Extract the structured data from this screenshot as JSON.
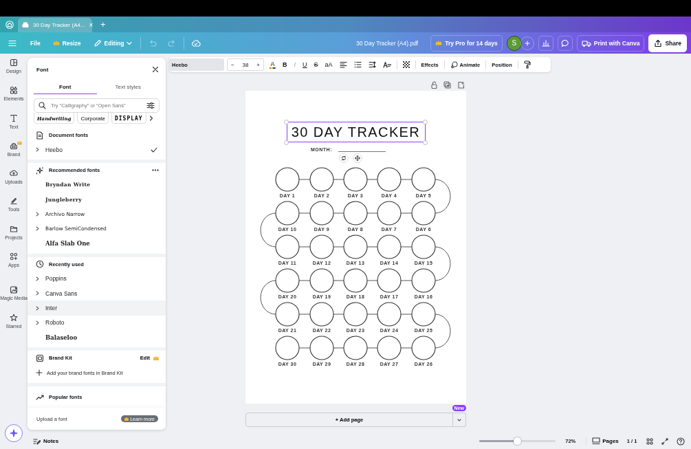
{
  "browser_tab": {
    "title": "30 Day Tracker (A4...",
    "close": "×",
    "new_tab": "+"
  },
  "toolbar": {
    "file": "File",
    "resize": "Resize",
    "editing": "Editing",
    "document_name": "30 Day Tracker (A4).pdf",
    "try_pro": "Try Pro for 14 days",
    "avatar": "S",
    "print": "Print with Canva",
    "share": "Share"
  },
  "rail": [
    {
      "label": "Design",
      "badge": false
    },
    {
      "label": "Elements",
      "badge": false
    },
    {
      "label": "Text",
      "badge": false
    },
    {
      "label": "Brand",
      "badge": true
    },
    {
      "label": "Uploads",
      "badge": false
    },
    {
      "label": "Tools",
      "badge": false
    },
    {
      "label": "Projects",
      "badge": false
    },
    {
      "label": "Apps",
      "badge": false
    },
    {
      "label": "Magic Media",
      "badge": false
    },
    {
      "label": "Starred",
      "badge": false
    }
  ],
  "font_panel": {
    "title": "Font",
    "tabs": [
      {
        "label": "Font",
        "selected": true
      },
      {
        "label": "Text styles",
        "selected": false
      }
    ],
    "search": {
      "placeholder": "Try “Calligraphy” or “Open Sans”"
    },
    "categories": [
      "Handwriting",
      "Corporate",
      "DISPLAY"
    ],
    "sections": [
      {
        "kind": "document",
        "title": "Document fonts",
        "items": [
          {
            "name": "Heebo",
            "kind": "expandable",
            "checked": true,
            "highlighted": false
          }
        ]
      },
      {
        "kind": "recommended",
        "title": "Recommended fonts",
        "items": [
          {
            "name": "Bryndan Write",
            "kind": "script",
            "checked": false,
            "highlighted": false
          },
          {
            "name": "Jungleberry",
            "kind": "script",
            "checked": false,
            "highlighted": false
          },
          {
            "name": "Archivo Narrow",
            "kind": "expandable",
            "checked": false,
            "highlighted": false
          },
          {
            "name": "Barlow SemiCondensed",
            "kind": "expandable",
            "checked": false,
            "highlighted": false
          },
          {
            "name": "Alfa Slab One",
            "kind": "slab",
            "checked": false,
            "highlighted": false
          }
        ]
      },
      {
        "kind": "recent",
        "title": "Recently used",
        "items": [
          {
            "name": "Poppins",
            "kind": "expandable",
            "checked": false,
            "highlighted": false
          },
          {
            "name": "Canva Sans",
            "kind": "expandable",
            "checked": false,
            "highlighted": false
          },
          {
            "name": "Inter",
            "kind": "expandable",
            "checked": false,
            "highlighted": true
          },
          {
            "name": "Roboto",
            "kind": "expandable",
            "checked": false,
            "highlighted": false
          },
          {
            "name": "Balaseloo",
            "kind": "slab",
            "checked": false,
            "highlighted": false
          }
        ]
      }
    ],
    "brand_kit": {
      "title": "Brand Kit",
      "edit": "Edit",
      "add": "Add your brand fonts in Brand Kit"
    },
    "popular": "Popular fonts",
    "upload": "Upload a font",
    "learn_more": "Learn more"
  },
  "text_toolbar": {
    "font": "Heebo",
    "minus": "−",
    "size": "38",
    "plus": "+",
    "color_letter": "A",
    "bold": "B",
    "italic": "I",
    "underline": "U",
    "strike": "S",
    "case": "aA",
    "effects": "Effects",
    "animate": "Animate",
    "position": "Position"
  },
  "document": {
    "title": "30 DAY TRACKER",
    "title_selected": true,
    "month_label": "MONTH:",
    "rows": [
      [
        "DAY 1",
        "DAY 2",
        "DAY 3",
        "DAY 4",
        "DAY 5"
      ],
      [
        "DAY 10",
        "DAY 9",
        "DAY 8",
        "DAY 7",
        "DAY 6"
      ],
      [
        "DAY 11",
        "DAY 12",
        "DAY 13",
        "DAY 14",
        "DAY 15"
      ],
      [
        "DAY 20",
        "DAY 19",
        "DAY 18",
        "DAY 17",
        "DAY 16"
      ],
      [
        "DAY 21",
        "DAY 22",
        "DAY 23",
        "DAY 24",
        "DAY 25"
      ],
      [
        "DAY 30",
        "DAY 29",
        "DAY 28",
        "DAY 27",
        "DAY 26"
      ]
    ]
  },
  "add_page": {
    "label": "+ Add page",
    "badge": "New"
  },
  "bottom_bar": {
    "notes": "Notes",
    "zoom": {
      "level": 0.5
    },
    "zoom_reading": "72%",
    "pages": "Pages",
    "page_count": "1 / 1"
  }
}
